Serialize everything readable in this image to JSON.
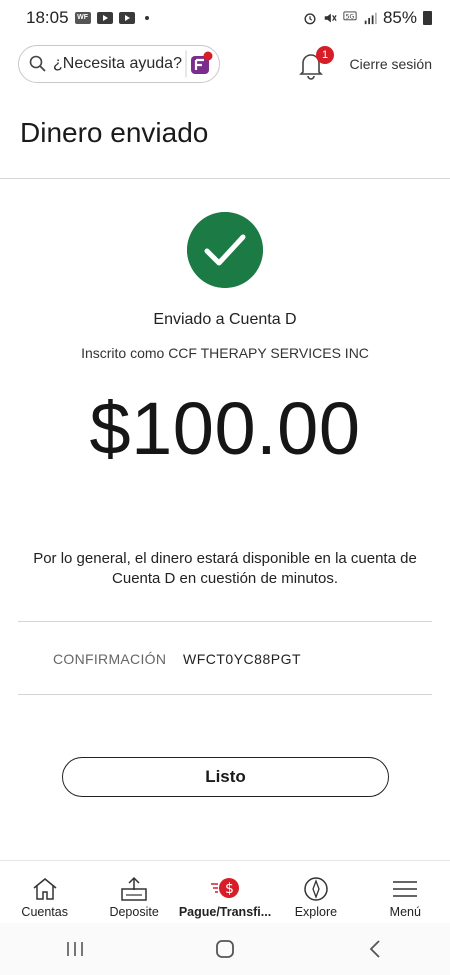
{
  "status_bar": {
    "time": "18:05",
    "battery": "85%"
  },
  "header": {
    "search_label": "¿Necesita ayuda?",
    "notifications_count": "1",
    "logout_label": "Cierre sesión"
  },
  "page": {
    "title": "Dinero enviado"
  },
  "confirmation": {
    "sent_to": "Enviado a Cuenta D",
    "enrolled_as": "Inscrito como CCF THERAPY SERVICES INC",
    "amount": "$100.00",
    "availability_note": "Por lo general, el dinero estará disponible en la cuenta de Cuenta D en cuestión de minutos.",
    "confirmation_label": "CONFIRMACIÓN",
    "confirmation_number": "WFCT0YC88PGT",
    "done_label": "Listo"
  },
  "bottom_nav": {
    "items": [
      {
        "label": "Cuentas",
        "icon": "house-icon"
      },
      {
        "label": "Deposite",
        "icon": "deposit-icon"
      },
      {
        "label": "Pague/Transfi...",
        "icon": "pay-transfer-icon",
        "active": true
      },
      {
        "label": "Explore",
        "icon": "compass-icon"
      },
      {
        "label": "Menú",
        "icon": "menu-icon"
      }
    ]
  },
  "colors": {
    "success_green": "#1c7a45",
    "brand_red": "#d71e28",
    "brand_purple": "#7b2d8e"
  }
}
